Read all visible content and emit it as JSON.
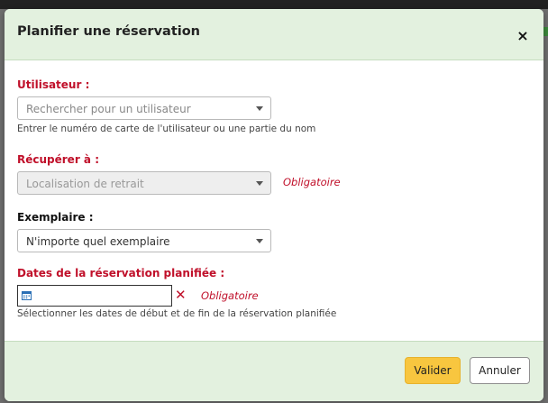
{
  "modal": {
    "title": "Planifier une réservation",
    "close_symbol": "×",
    "user": {
      "label": "Utilisateur :",
      "placeholder": "Rechercher pour un utilisateur",
      "hint": "Entrer le numéro de carte de l'utilisateur ou une partie du nom"
    },
    "pickup": {
      "label": "Récupérer à :",
      "placeholder": "Localisation de retrait",
      "required": "Obligatoire"
    },
    "item": {
      "label": "Exemplaire :",
      "value": "N'importe quel exemplaire"
    },
    "dates": {
      "label": "Dates de la réservation planifiée :",
      "value": "",
      "required": "Obligatoire",
      "hint": "Sélectionner les dates de début et de fin de la réservation planifiée",
      "clear_symbol": "✕"
    },
    "footer": {
      "submit_label": "Valider",
      "cancel_label": "Annuler"
    }
  },
  "colors": {
    "header_bg": "#e3f1df",
    "required_red": "#c0102a",
    "primary_button": "#f8c63f"
  }
}
